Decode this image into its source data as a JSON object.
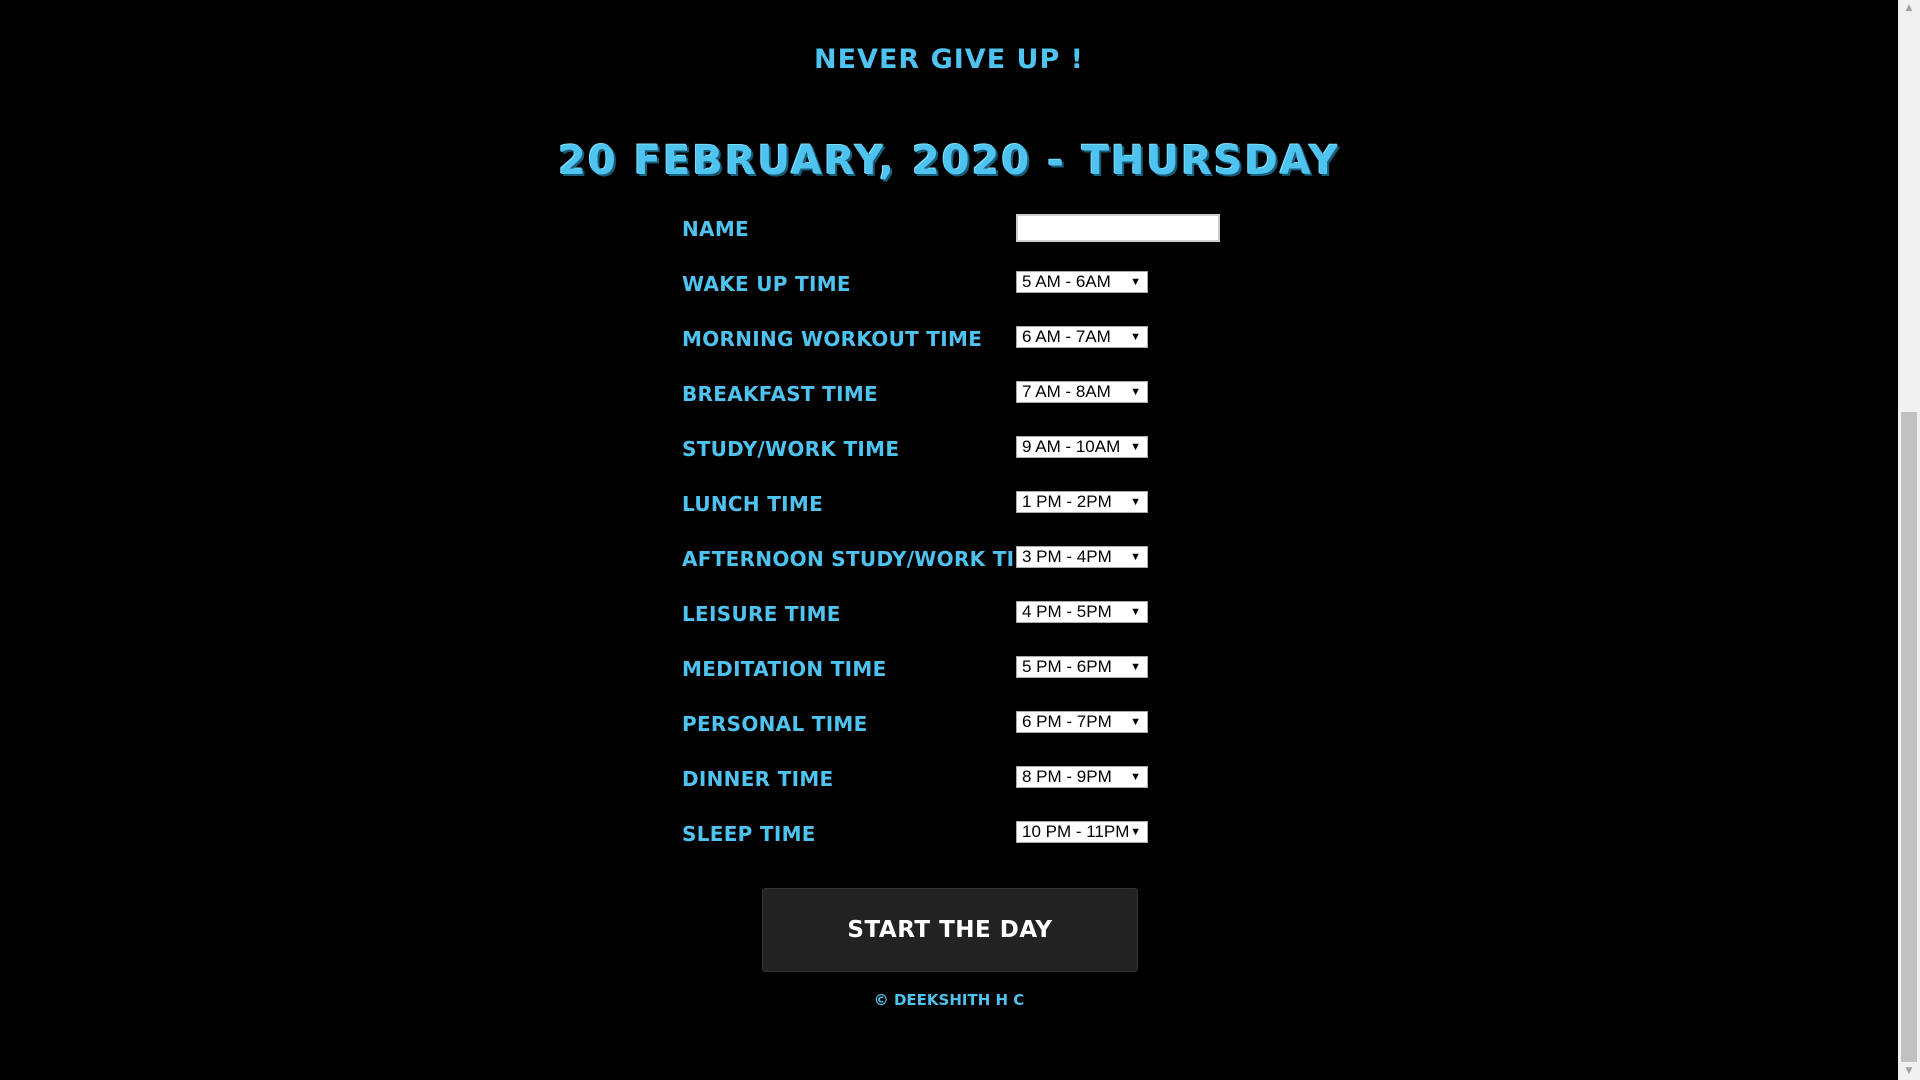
{
  "header": {
    "tagline": "NEVER GIVE UP !",
    "date": "20 FEBRUARY, 2020 - THURSDAY"
  },
  "form": {
    "name_label": "NAME",
    "name_value": "",
    "rows": [
      {
        "label": "WAKE UP TIME",
        "value": "5 AM - 6AM"
      },
      {
        "label": "MORNING WORKOUT TIME",
        "value": "6 AM - 7AM"
      },
      {
        "label": "BREAKFAST TIME",
        "value": "7 AM - 8AM"
      },
      {
        "label": "STUDY/WORK TIME",
        "value": "9 AM - 10AM"
      },
      {
        "label": "LUNCH TIME",
        "value": "1 PM - 2PM"
      },
      {
        "label": "AFTERNOON STUDY/WORK TIME",
        "value": "3 PM - 4PM"
      },
      {
        "label": "LEISURE TIME",
        "value": "4 PM - 5PM"
      },
      {
        "label": "MEDITATION TIME",
        "value": "5 PM - 6PM"
      },
      {
        "label": "PERSONAL TIME",
        "value": "6 PM - 7PM"
      },
      {
        "label": "DINNER TIME",
        "value": "8 PM - 9PM"
      },
      {
        "label": "SLEEP TIME",
        "value": "10 PM - 11PM"
      }
    ],
    "select_caret": "▼"
  },
  "actions": {
    "start_label": "START THE DAY"
  },
  "footer": {
    "credit": "© DEEKSHITH H C"
  },
  "scrollbar": {
    "up_arrow": "▲",
    "down_arrow": "▼"
  },
  "colors": {
    "accent": "#4fc3ef",
    "background": "#000000",
    "button": "#222222"
  }
}
